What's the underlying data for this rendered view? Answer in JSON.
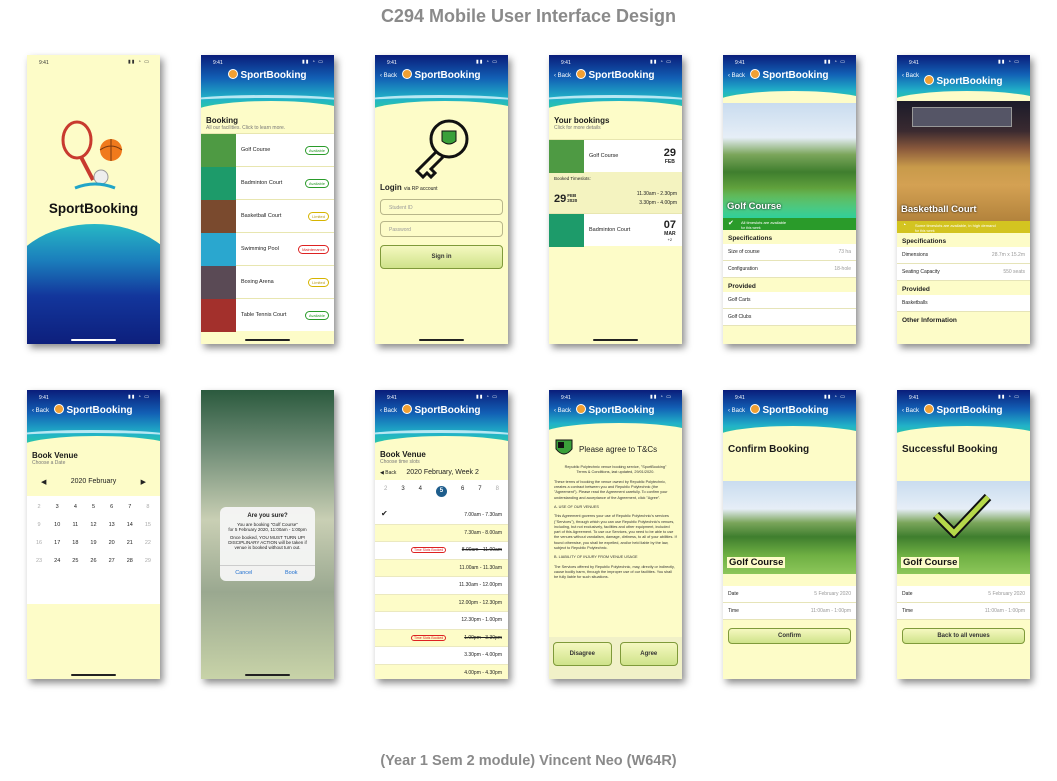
{
  "title": "C294 Mobile User Interface Design",
  "footer": "(Year 1 Sem 2 module)  Vincent Neo (W64R)",
  "status_time": "9:41",
  "brand_name": "SportBooking",
  "back_label": "Back",
  "splash": {
    "name": "SportBooking"
  },
  "booking": {
    "title": "Booking",
    "subtitle": "All our facilities. Click to learn more.",
    "venues": [
      {
        "name": "Golf Course",
        "status": "Available",
        "kind": "av",
        "color": "#4e9a43"
      },
      {
        "name": "Badminton Court",
        "status": "Available",
        "kind": "av",
        "color": "#1d9b6a"
      },
      {
        "name": "Basketball Court",
        "status": "Limited",
        "kind": "li",
        "color": "#7a4a2e"
      },
      {
        "name": "Swimming Pool",
        "status": "Maintenance",
        "kind": "ma",
        "color": "#2aa7cf"
      },
      {
        "name": "Boxing Arena",
        "status": "Limited",
        "kind": "li",
        "color": "#5a4a55"
      },
      {
        "name": "Table Tennis Court",
        "status": "Available",
        "kind": "av",
        "color": "#a3302c"
      }
    ]
  },
  "login": {
    "title": "Login",
    "via": "via RP account",
    "student_id_placeholder": "Student ID",
    "password_placeholder": "Password",
    "sign_in": "Sign in"
  },
  "your_bookings": {
    "title": "Your bookings",
    "subtitle": "Click for more details",
    "b1": {
      "venue": "Golf Course",
      "day": "29",
      "mon": "FEB"
    },
    "timeslots_label": "Booked Timeslots:",
    "ts": {
      "day": "29",
      "mon": "FEB",
      "year": "2020",
      "t1": "11.30am - 2.30pm",
      "t2": "3.30pm - 4.00pm"
    },
    "b2": {
      "venue": "Badminton Court",
      "day": "07",
      "mon": "MAR",
      "extra": "+2"
    }
  },
  "golf_detail": {
    "name": "Golf Course",
    "banner": "All timeslots are available",
    "banner_sub": "for this week",
    "specs_title": "Specifications",
    "specs": [
      {
        "k": "Size of course",
        "v": "73 ha"
      },
      {
        "k": "Configuration",
        "v": "18-hole"
      }
    ],
    "provided_title": "Provided",
    "provided": [
      "Golf Carts",
      "Golf Clubs"
    ]
  },
  "bball_detail": {
    "name": "Basketball Court",
    "banner": "Some timeslots are available, in high demand",
    "banner_sub": "for this week",
    "specs_title": "Specifications",
    "specs": [
      {
        "k": "Dimensions",
        "v": "28.7m x 15.2m"
      },
      {
        "k": "Seating Capacity",
        "v": "550 seats"
      }
    ],
    "provided_title": "Provided",
    "provided": [
      "Basketballs"
    ],
    "other_title": "Other Information"
  },
  "book_venue": {
    "title": "Book Venue",
    "subtitle": "Choose a Date",
    "month": "2020 February",
    "days": [
      [
        "2",
        "3",
        "4",
        "5",
        "6",
        "7",
        "8"
      ],
      [
        "9",
        "10",
        "11",
        "12",
        "13",
        "14",
        "15"
      ],
      [
        "16",
        "17",
        "18",
        "19",
        "20",
        "21",
        "22"
      ],
      [
        "23",
        "24",
        "25",
        "26",
        "27",
        "28",
        "29"
      ]
    ]
  },
  "confirm_dialog": {
    "title": "Are you sure?",
    "line1": "You are booking \"Golf Course\"",
    "line2": "for 5 February 2020, 11:00am - 1:00pm",
    "line3": "Once booked, YOU MUST TURN UP!",
    "line4": "DISCIPLINARY ACTION will be taken if",
    "line5": "venue is booked without turn out.",
    "cancel": "Cancel",
    "book": "Book"
  },
  "timeslots": {
    "title": "Book Venue",
    "subtitle": "Choose time slots",
    "week": "2020 February, Week 2",
    "days": [
      "2",
      "3",
      "4",
      "5",
      "6",
      "7",
      "8"
    ],
    "slots": [
      {
        "t": "7.00am - 7.30am",
        "check": true
      },
      {
        "t": "7.30am - 8.00am"
      },
      {
        "t": "8.00am - 11.00am",
        "booked": true
      },
      {
        "t": "11.00am - 11.30am"
      },
      {
        "t": "11.30am - 12.00pm"
      },
      {
        "t": "12.00pm - 12.30pm"
      },
      {
        "t": "12.30pm - 1.00pm"
      },
      {
        "t": "1.00pm - 3.30pm",
        "booked": true
      },
      {
        "t": "3.30pm - 4.00pm"
      },
      {
        "t": "4.00pm - 4.30pm"
      }
    ],
    "booked_tag": "Time Slots Booked"
  },
  "terms": {
    "title": "Please agree to T&Cs",
    "intro": "Republic Polytechnic venue booking service, \"SportBooking\"\nTerms & Conditions, last updated, 29/01/2020.",
    "p1": "These terms of booking the venue owned by Republic Polytechnic, creates a contract between you and Republic Polytechnic (the \"Agreement\"). Please read the Agreement carefully. To confirm your understanding and acceptance of the Agreement, click \"Agree\".",
    "h_a": "A. USE OF OUR VENUES",
    "p2": "This Agreement governs your use of Republic Polytechnic's services (\"Services\"), through which you can use Republic Polytechnic's venues, including, but not exclusively, facilities and other equipment, included part of this Agreement. To use our Services, you need to be able to use the venues without vandalism, damage, dirtiness, to all of your abilities. If found otherwise, you shall be expelled, and/or held liable by the law, subject to Republic Polytechnic.",
    "h_b": "B. LIABILITY OF INJURY FROM VENUE USAGE",
    "p3": "The Services offered by Republic Polytechnic, may, directly or indirectly, cause bodily harm, through the improper use of our facilities. You shall be fully liable for such situations.",
    "disagree": "Disagree",
    "agree": "Agree"
  },
  "confirm": {
    "title": "Confirm Booking",
    "venue": "Golf Course",
    "date_k": "Date",
    "date_v": "5 February 2020",
    "time_k": "Time",
    "time_v": "11:00am - 1:00pm",
    "button": "Confirm"
  },
  "success": {
    "title": "Successful Booking",
    "venue": "Golf Course",
    "date_k": "Date",
    "date_v": "5 February 2020",
    "time_k": "Time",
    "time_v": "11:00am - 1:00pm",
    "button": "Back to all venues"
  }
}
